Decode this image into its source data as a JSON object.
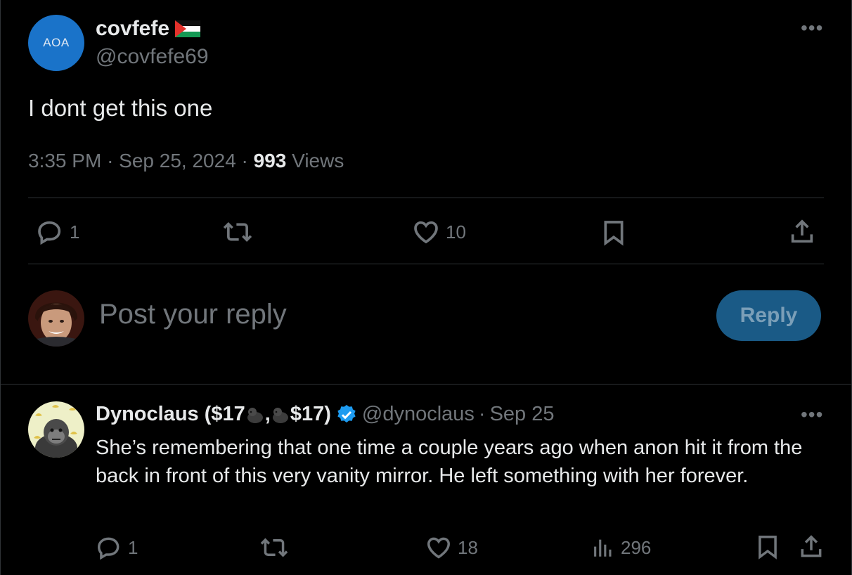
{
  "post": {
    "avatar_text": "AOA",
    "display_name": "covfefe",
    "handle": "@covfefe69",
    "more_icon": "more-horizontal-icon",
    "text": "I dont get this one",
    "time": "3:35 PM",
    "date": "Sep 25, 2024",
    "views_count": "993",
    "views_label": "Views",
    "separator": "·",
    "actions": {
      "replies": "1",
      "reposts": "",
      "likes": "10"
    }
  },
  "composer": {
    "placeholder": "Post your reply",
    "button_label": "Reply"
  },
  "reply": {
    "display_name_part1": "Dynoclaus ($17",
    "display_name_part2": ",",
    "display_name_part3": "$17)",
    "handle": "@dynoclaus",
    "separator": "·",
    "date": "Sep 25",
    "text": "She’s remembering that one time a couple years ago when anon hit it from the back in front of this very vanity mirror. He left something with her forever.",
    "actions": {
      "replies": "1",
      "likes": "18",
      "views": "296"
    }
  },
  "colors": {
    "background": "#000000",
    "text": "#e7e9ea",
    "muted": "#71767b",
    "divider": "#2f3336",
    "accent": "#1d9bf0",
    "reply_button": "#1a5a86"
  }
}
